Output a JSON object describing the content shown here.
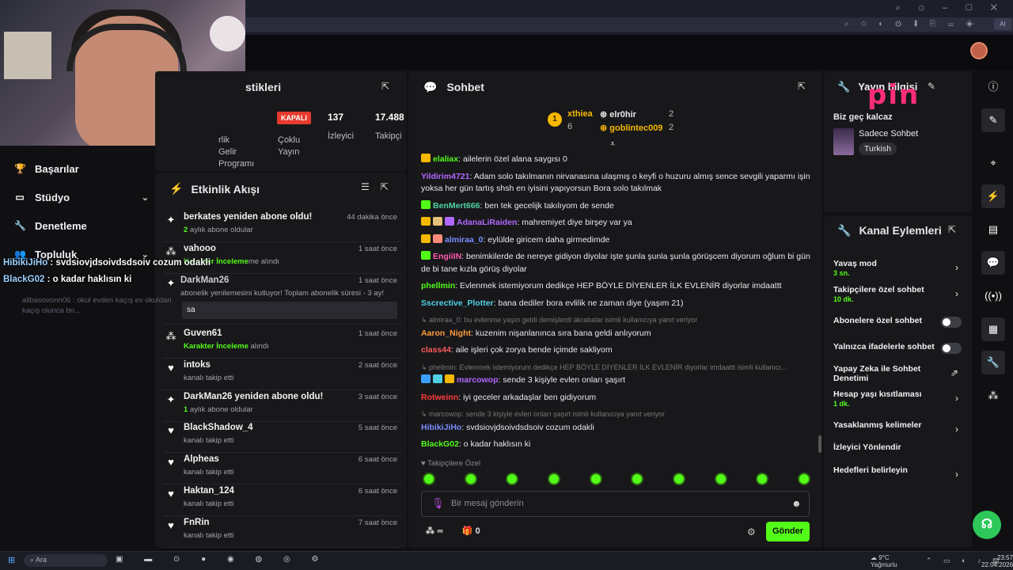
{
  "nav": {
    "items": [
      {
        "label": "Başarılar",
        "icon": "trophy-icon"
      },
      {
        "label": "Stüdyo",
        "icon": "monitor-icon"
      },
      {
        "label": "Denetleme",
        "icon": "wrench-icon"
      },
      {
        "label": "Topluluk",
        "icon": "people-icon"
      }
    ]
  },
  "overlay_chat": {
    "lines": [
      {
        "user": "HibikiJiHo",
        "text": " : svdsiovjdsoivdsdsoiv cozum odakli"
      },
      {
        "user": "BlackG02",
        "text": " : o kadar haklısın ki"
      }
    ],
    "faded": "alibasovonn06 : okul evden kaçış ev okuldan kaçış olunca bn...",
    "dark_user": "DarkMan26"
  },
  "stats": {
    "title": "stikleri",
    "col1": "rlik\nGelir\nProgramı",
    "kapali": "KAPALI",
    "col2": "Çoklu\nYayın",
    "viewers": "137",
    "viewers_label": "İzleyici",
    "followers": "17.488",
    "followers_label": "Takipçi"
  },
  "activity": {
    "title": "Etkinlik Akışı",
    "rows": [
      {
        "icon": "sparkle-icon",
        "name": "berkates yeniden abone oldu!",
        "sub_b": "2",
        "sub": " aylık abone oldular",
        "time": "44 dakika önce"
      },
      {
        "icon": "gift-icon",
        "name": "vahooo",
        "sub_b": "Karakter İnceleme",
        "sub": "me alındı",
        "time": "1 saat önce"
      },
      {
        "icon": "sparkle-icon",
        "name": "DarkMan26",
        "sub_b": "",
        "sub": "abonelik yenilemesini kutluyor! Toplam abonelik süresi - 3 ay!",
        "time": "1 saat önce",
        "msg": "sa"
      },
      {
        "icon": "gift-icon",
        "name": "Guven61",
        "sub_b": "Karakter İnceleme",
        "sub": " alındı",
        "time": "1 saat önce"
      },
      {
        "icon": "heart-icon",
        "name": "intoks",
        "sub_b": "",
        "sub": "kanalı takip etti",
        "time": "2 saat önce"
      },
      {
        "icon": "sparkle-icon",
        "name": "DarkMan26 yeniden abone oldu!",
        "sub_b": "1",
        "sub": " aylık abone oldular",
        "time": "3 saat önce"
      },
      {
        "icon": "heart-icon",
        "name": "BlackShadow_4",
        "sub_b": "",
        "sub": "kanalı takip etti",
        "time": "5 saat önce"
      },
      {
        "icon": "heart-icon",
        "name": "Alpheas",
        "sub_b": "",
        "sub": "kanalı takip etti",
        "time": "6 saat önce"
      },
      {
        "icon": "heart-icon",
        "name": "Haktan_124",
        "sub_b": "",
        "sub": "kanalı takip etti",
        "time": "6 saat önce"
      },
      {
        "icon": "heart-icon",
        "name": "FnRin",
        "sub_b": "",
        "sub": "kanalı takip etti",
        "time": "7 saat önce"
      }
    ]
  },
  "chat": {
    "title": "Sohbet",
    "leader": {
      "first": {
        "rank": "1",
        "name": "xthiea",
        "count": "6"
      },
      "second": {
        "name": "elr0hir",
        "count": "2"
      },
      "third": {
        "name": "goblintec009",
        "count": "2"
      }
    },
    "messages": [
      {
        "user": "elaliax",
        "color": "#53fc18",
        "text": ": ailelerin özel alana saygısı 0",
        "badges": [
          "#f5b800"
        ]
      },
      {
        "user": "Yildirim4721",
        "color": "#b168ff",
        "text": ": Adam solo takılmanın nirvanasına ulaşmış o keyfi o huzuru almış sence sevgili yaparmı işin yoksa her gün tartış shsh en iyisini yapıyorsun Bora solo takılmak",
        "badges": []
      },
      {
        "user": "BenMert666",
        "color": "#4fd1a5",
        "text": ": ben tek gecelijk takılıyom de sende",
        "badges": [
          "#53fc18"
        ]
      },
      {
        "user": "AdanaLiRaiden",
        "color": "#b168ff",
        "text": ": mahremiyet diye birşey var ya",
        "badges": [
          "#f5b800",
          "#e5c07b",
          "#b168ff"
        ]
      },
      {
        "user": "almiraa_0",
        "color": "#7c8cff",
        "text": ": eylülde giricem daha girmedimde",
        "badges": [
          "#f5b800",
          "#ff8a7a"
        ]
      },
      {
        "user": "EngiiIN",
        "color": "#ff5ab0",
        "text": ": benimkilerde de nereye gidiyon diyolar işte şunla şunla şunla görüşcem diyorum oğlum bi gün de bi tane kızla görüş diyolar",
        "badges": [
          "#53fc18"
        ]
      },
      {
        "user": "phellmin",
        "color": "#53fc18",
        "text": ": Evlenmek istemiyorum dedikçe HEP BÖYLE DİYENLER İLK EVLENİR diyorlar imdaattt",
        "badges": []
      },
      {
        "user": "Sscrective_Plotter",
        "color": "#4fd1e5",
        "text": ": bana dediler bora evlilik ne zaman diye (yaşım 21)",
        "badges": []
      },
      {
        "reply": "↳ almiraa_0: bu evlenme yaşın geldi demişlerdi akrabalar isimli kullanıcıya yanıt veriyor"
      },
      {
        "user": "Aaron_Night",
        "color": "#ff9a3c",
        "text": ": kuzenim nişanlanınca sıra bana geldi anlıyorum",
        "badges": []
      },
      {
        "user": "class44",
        "color": "#ff5a5a",
        "text": ": aile işleri çok zorya bende içimde sakliyom",
        "badges": []
      },
      {
        "reply": "↳ phellmin: Evlenmek istemiyorum dedikçe HEP BÖYLE DİYENLER İLK EVLENİR diyorlar imdaattt isimli kullanıcı..."
      },
      {
        "user": "marcowop",
        "color": "#b168ff",
        "text": ": sende 3 kişiyle evlen onları şaşırt",
        "badges": [
          "#3aa0ff",
          "#4fd1e5",
          "#f5b800"
        ]
      },
      {
        "user": "Rotweinn",
        "color": "#ff3b3b",
        "text": ": iyi geceler arkadaşlar ben gidiyorum",
        "badges": []
      },
      {
        "reply": "↳ marcowop: sende 3 kişiyle evlen onları şaşırt isimli kullanıcıya yanıt veriyor"
      },
      {
        "user": "HibikiJiHo",
        "color": "#7c8cff",
        "text": ": svdsiovjdsoivdsdsoiv cozum odakli",
        "badges": []
      },
      {
        "user": "BlackG02",
        "color": "#53fc18",
        "text": ": o kadar haklısın ki",
        "badges": []
      }
    ],
    "followers_only": "♥ Takipçilere Özel",
    "input_placeholder": "Bir mesaj gönderin",
    "points": "∞",
    "count": "0",
    "send": "Gönder"
  },
  "info": {
    "title": "Yayın bilgisi",
    "late": "Biz geç kalcaz",
    "category": "Sadece Sohbet",
    "tag": "Turkish",
    "logo": "pin"
  },
  "actions": {
    "title": "Kanal Eylemleri",
    "rows": [
      {
        "label": "Yavaş mod",
        "sub": "3 sn.",
        "type": "chevron"
      },
      {
        "label": "Takipçilere özel sohbet",
        "sub": "10 dk.",
        "type": "chevron"
      },
      {
        "label": "Abonelere özel sohbet",
        "sub": "",
        "type": "toggle"
      },
      {
        "label": "Yalnızca ifadelerle sohbet",
        "sub": "",
        "type": "toggle"
      },
      {
        "label": "Yapay Zeka ile Sohbet Denetimi",
        "sub": "",
        "type": "external"
      },
      {
        "label": "Hesap yaşı kısıtlaması",
        "sub": "1 dk.",
        "type": "chevron"
      },
      {
        "label": "Yasaklanmış kelimeler",
        "sub": "",
        "type": "chevron"
      },
      {
        "label": "İzleyici Yönlendir",
        "sub": "",
        "type": "none"
      },
      {
        "label": "Hedefleri belirleyin",
        "sub": "",
        "type": "chevron"
      }
    ]
  },
  "taskbar": {
    "search": "Ara",
    "weather_temp": "9°C",
    "weather_desc": "Yağmurlu",
    "time": "23:57",
    "date": "22.04.2026"
  },
  "colors": {
    "accent": "#53fc18",
    "panel": "#18181b",
    "bg": "#101013",
    "kapali": "#e63b2e"
  }
}
